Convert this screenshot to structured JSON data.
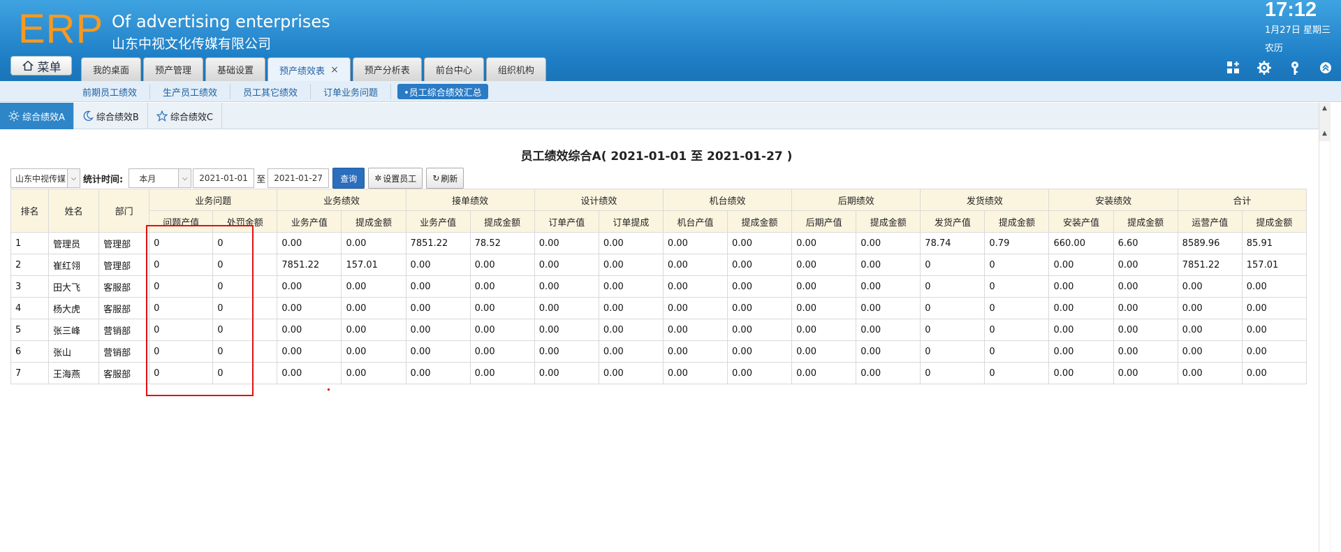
{
  "header": {
    "logo": "ERP",
    "company_en": "Of advertising enterprises",
    "company_cn": "山东中视文化传媒有限公司",
    "menu_label": "菜单",
    "time": "17:12",
    "date": "1月27日 星期三",
    "lunar": "农历"
  },
  "tabs": [
    {
      "label": "我的桌面"
    },
    {
      "label": "预产管理"
    },
    {
      "label": "基础设置"
    },
    {
      "label": "预产绩效表",
      "active": true,
      "close": "×"
    },
    {
      "label": "预产分析表"
    },
    {
      "label": "前台中心"
    },
    {
      "label": "组织机构"
    }
  ],
  "subnav": [
    {
      "label": "前期员工绩效"
    },
    {
      "label": "生产员工绩效"
    },
    {
      "label": "员工其它绩效"
    },
    {
      "label": "订单业务问题"
    },
    {
      "label": "•员工综合绩效汇总",
      "active": true
    }
  ],
  "content_tabs": [
    {
      "label": "综合绩效A",
      "icon": "sun-icon",
      "active": true
    },
    {
      "label": "综合绩效B",
      "icon": "moon-icon"
    },
    {
      "label": "综合绩效C",
      "icon": "star-icon"
    }
  ],
  "report_title": "员工绩效综合A( 2021-01-01 至 2021-01-27 )",
  "filter": {
    "company": "山东中视传媒",
    "stat_label": "统计时间:",
    "period": "本月",
    "date_from": "2021-01-01",
    "to_label": "至",
    "date_to": "2021-01-27",
    "query_label": "查询",
    "set_staff_label": "设置员工",
    "refresh_label": "刷新"
  },
  "table": {
    "fixed_headers": [
      "排名",
      "姓名",
      "部门"
    ],
    "groups": [
      "业务问题",
      "业务绩效",
      "接单绩效",
      "设计绩效",
      "机台绩效",
      "后期绩效",
      "发货绩效",
      "安装绩效",
      "合计"
    ],
    "sub_headers": [
      "问题产值",
      "处罚金额",
      "业务产值",
      "提成金额",
      "业务产值",
      "提成金额",
      "订单产值",
      "订单提成",
      "机台产值",
      "提成金额",
      "后期产值",
      "提成金额",
      "发货产值",
      "提成金额",
      "安装产值",
      "提成金额",
      "运营产值",
      "提成金额"
    ],
    "rows": [
      [
        "1",
        "管理员",
        "管理部",
        "0",
        "0",
        "0.00",
        "0.00",
        "7851.22",
        "78.52",
        "0.00",
        "0.00",
        "0.00",
        "0.00",
        "0.00",
        "0.00",
        "78.74",
        "0.79",
        "660.00",
        "6.60",
        "8589.96",
        "85.91"
      ],
      [
        "2",
        "崔红翎",
        "管理部",
        "0",
        "0",
        "7851.22",
        "157.01",
        "0.00",
        "0.00",
        "0.00",
        "0.00",
        "0.00",
        "0.00",
        "0.00",
        "0.00",
        "0",
        "0",
        "0.00",
        "0.00",
        "7851.22",
        "157.01"
      ],
      [
        "3",
        "田大飞",
        "客服部",
        "0",
        "0",
        "0.00",
        "0.00",
        "0.00",
        "0.00",
        "0.00",
        "0.00",
        "0.00",
        "0.00",
        "0.00",
        "0.00",
        "0",
        "0",
        "0.00",
        "0.00",
        "0.00",
        "0.00"
      ],
      [
        "4",
        "杨大虎",
        "客服部",
        "0",
        "0",
        "0.00",
        "0.00",
        "0.00",
        "0.00",
        "0.00",
        "0.00",
        "0.00",
        "0.00",
        "0.00",
        "0.00",
        "0",
        "0",
        "0.00",
        "0.00",
        "0.00",
        "0.00"
      ],
      [
        "5",
        "张三峰",
        "营销部",
        "0",
        "0",
        "0.00",
        "0.00",
        "0.00",
        "0.00",
        "0.00",
        "0.00",
        "0.00",
        "0.00",
        "0.00",
        "0.00",
        "0",
        "0",
        "0.00",
        "0.00",
        "0.00",
        "0.00"
      ],
      [
        "6",
        "张山",
        "营销部",
        "0",
        "0",
        "0.00",
        "0.00",
        "0.00",
        "0.00",
        "0.00",
        "0.00",
        "0.00",
        "0.00",
        "0.00",
        "0.00",
        "0",
        "0",
        "0.00",
        "0.00",
        "0.00",
        "0.00"
      ],
      [
        "7",
        "王海燕",
        "客服部",
        "0",
        "0",
        "0.00",
        "0.00",
        "0.00",
        "0.00",
        "0.00",
        "0.00",
        "0.00",
        "0.00",
        "0.00",
        "0.00",
        "0",
        "0",
        "0.00",
        "0.00",
        "0.00",
        "0.00"
      ]
    ]
  },
  "colors": {
    "header_top": "#3fa3e1",
    "header_bottom": "#1a74b8",
    "logo": "#f59a22",
    "link_blue": "#2473b8",
    "alert_red": "#e00000",
    "table_header_bg": "#fbf5e0",
    "active_tab": "#2e86c8"
  }
}
